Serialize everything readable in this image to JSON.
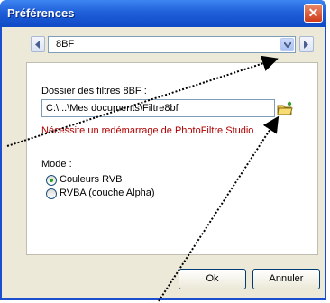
{
  "window": {
    "title": "Préférences",
    "close_glyph": "✕"
  },
  "selector": {
    "value": "8BF"
  },
  "folder": {
    "label": "Dossier des filtres 8BF :",
    "path": "C:\\...\\Mes documents\\Filtre8bf",
    "warning": "Nécessite un redémarrage de PhotoFiltre Studio"
  },
  "mode": {
    "label": "Mode :",
    "options": [
      {
        "label": "Couleurs RVB",
        "checked": true
      },
      {
        "label": "RVBA (couche Alpha)",
        "checked": false
      }
    ]
  },
  "buttons": {
    "ok": "Ok",
    "cancel": "Annuler"
  },
  "colors": {
    "warning_text": "#b00000",
    "title_bar": "#1f5fd8",
    "annotation": "#000000"
  }
}
